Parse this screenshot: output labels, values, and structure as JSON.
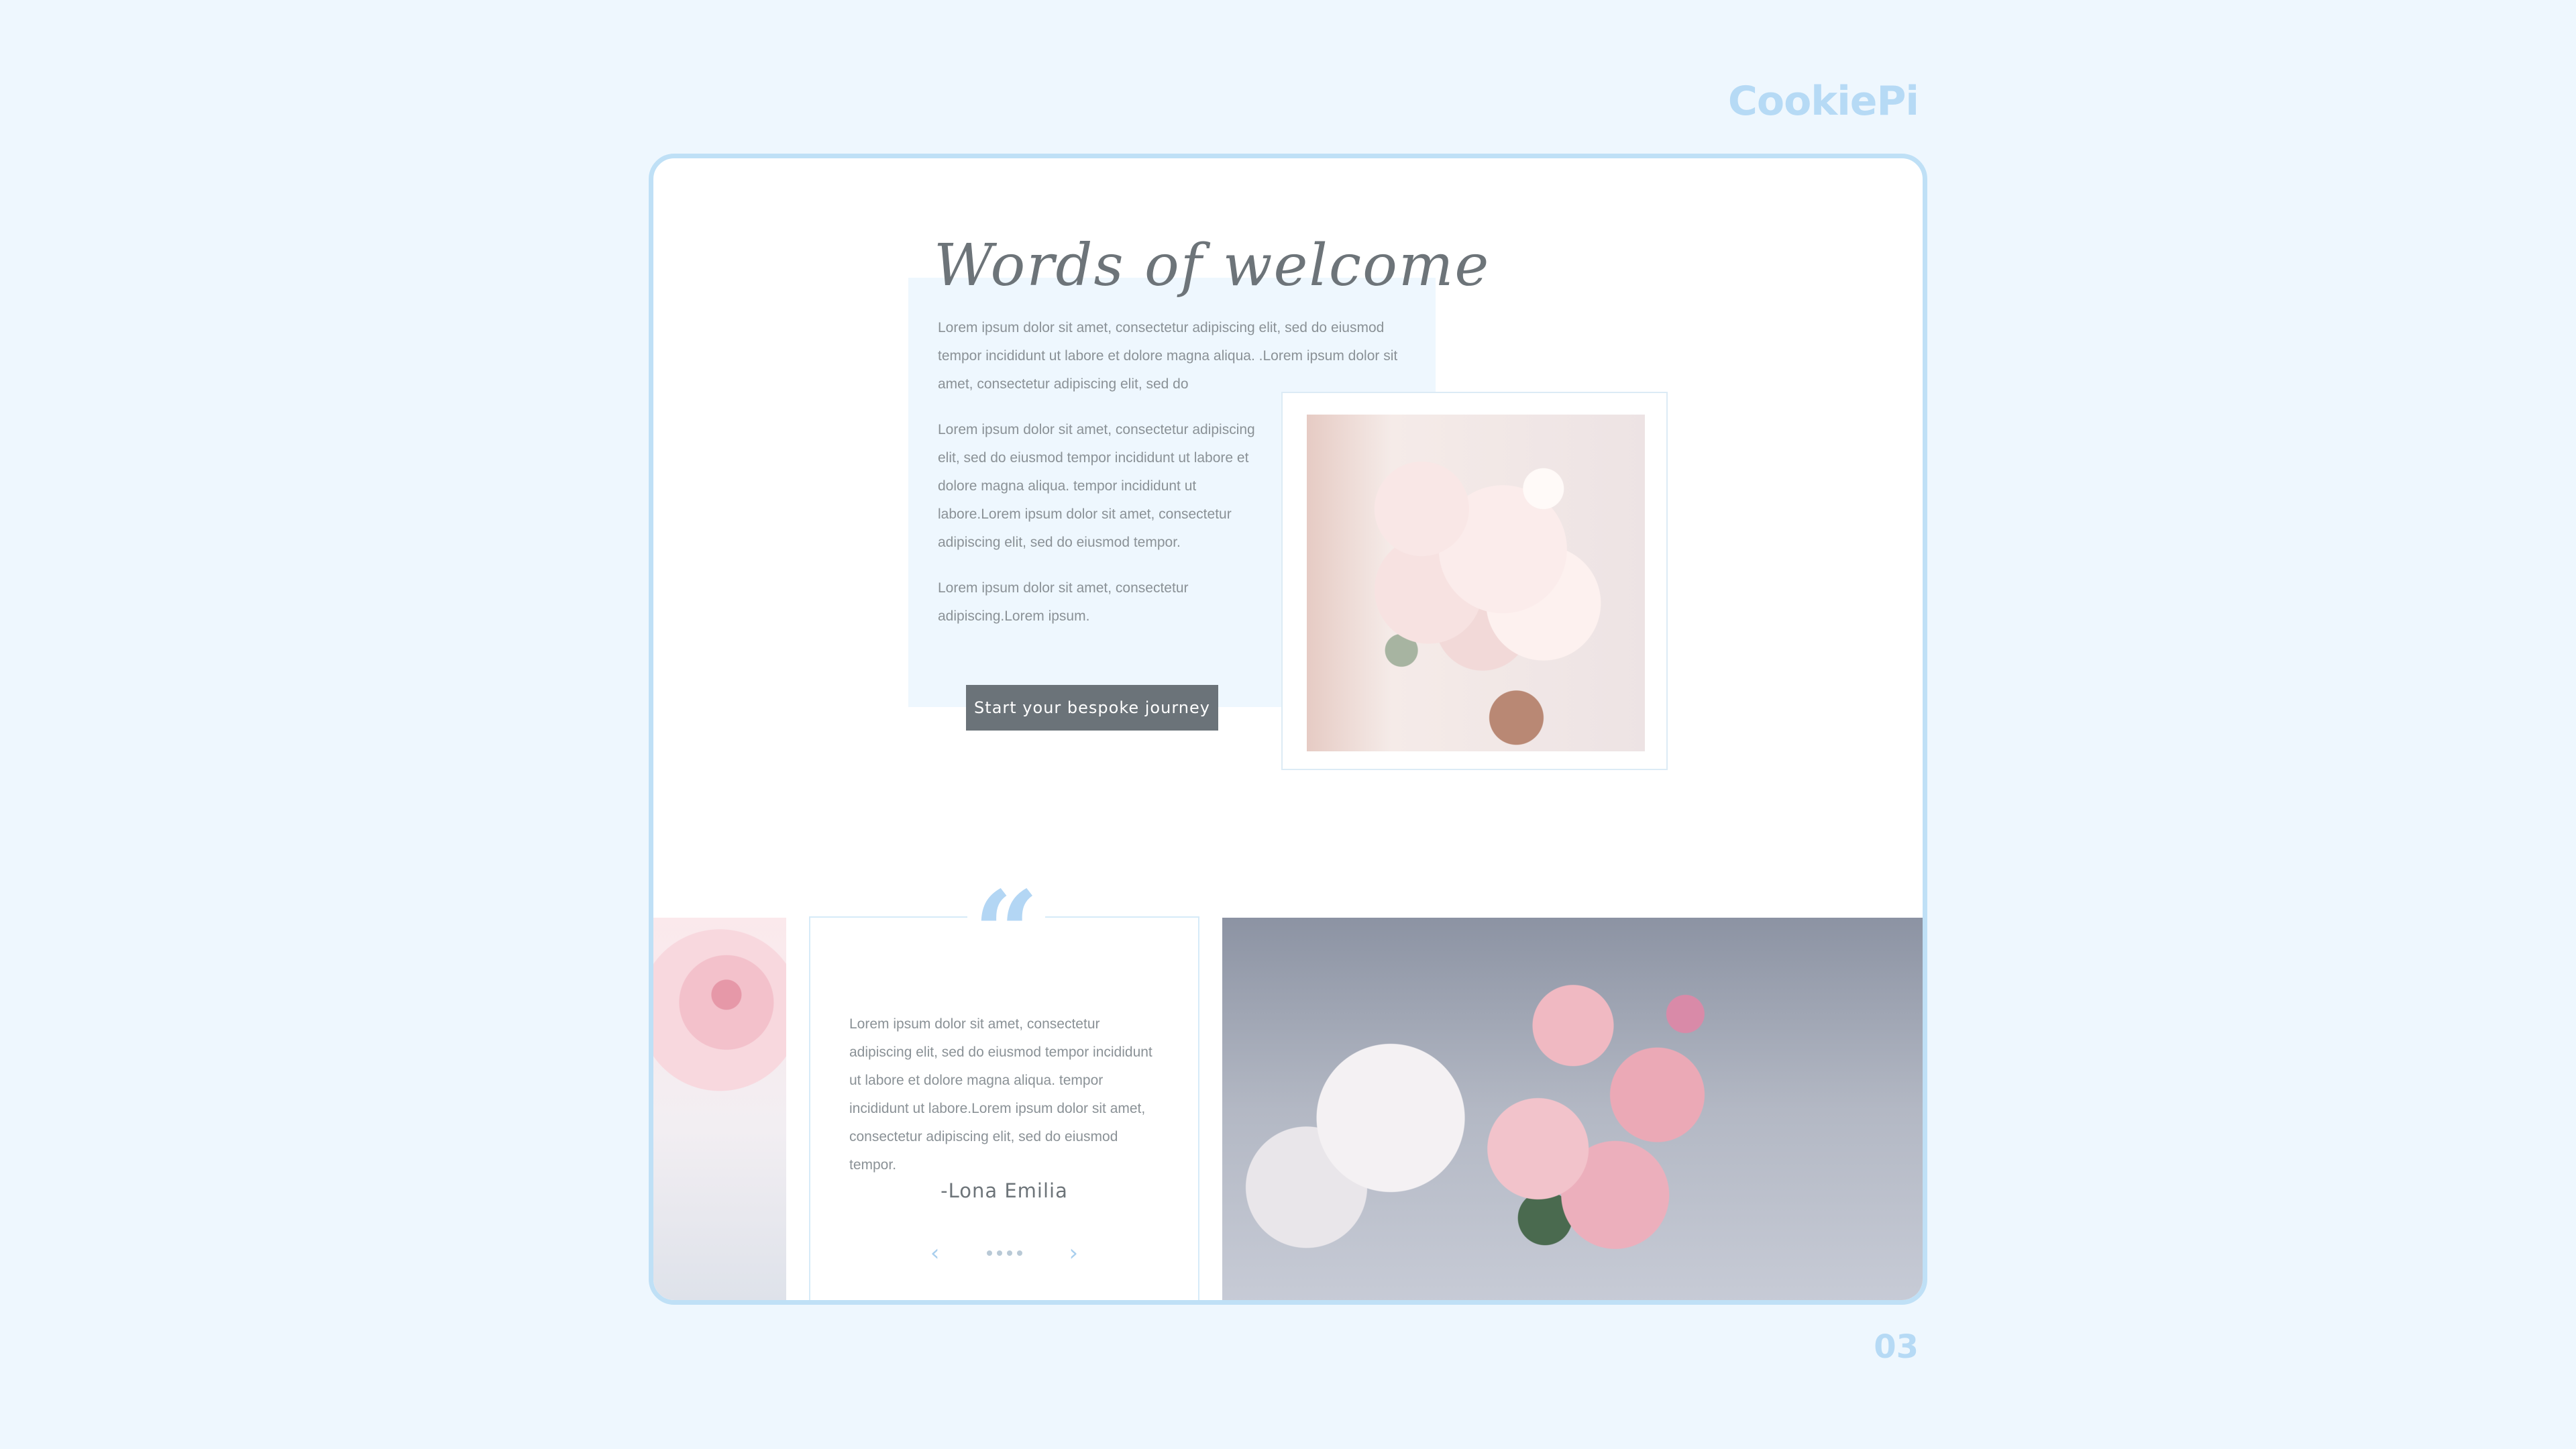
{
  "brand": "CookiePi",
  "page_number": "03",
  "welcome": {
    "title": "Words of welcome",
    "paragraph1": "Lorem ipsum dolor sit amet, consectetur adipiscing elit, sed do eiusmod tempor incididunt ut labore et dolore magna aliqua. .Lorem ipsum dolor sit amet, consectetur adipiscing elit, sed do",
    "paragraph2": "Lorem ipsum dolor sit amet, consectetur adipiscing elit, sed do eiusmod tempor incididunt ut labore et dolore magna aliqua. tempor incididunt ut labore.Lorem ipsum dolor sit amet, consectetur adipiscing elit, sed do eiusmod tempor.",
    "paragraph3": "Lorem ipsum dolor sit amet, consectetur adipiscing.Lorem ipsum.",
    "cta_label": "Start your bespoke journey"
  },
  "testimonial": {
    "quote_mark": "“",
    "text": "Lorem ipsum dolor sit amet, consectetur adipiscing elit, sed do eiusmod tempor incididunt ut labore et dolore magna aliqua. tempor incididunt ut labore.Lorem ipsum dolor sit amet, consectetur adipiscing elit, sed do eiusmod tempor.",
    "author": "-Lona Emilia",
    "prev_arrow": "‹",
    "next_arrow": "›",
    "dot_count": 4
  },
  "colors": {
    "background": "#eef7fe",
    "frame_border": "#bfe0f6",
    "accent_blue": "#b3d6f4",
    "button": "#6b7379"
  }
}
